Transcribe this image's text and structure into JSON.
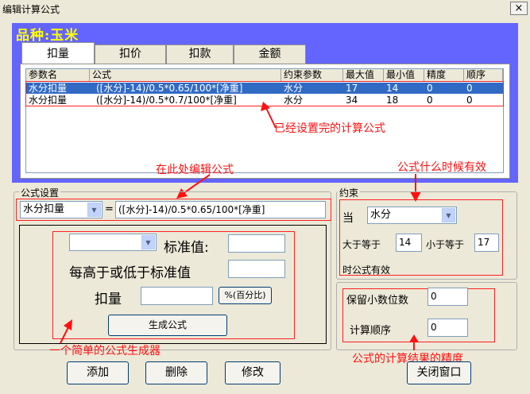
{
  "window": {
    "title": "编辑计算公式",
    "close_glyph": "×"
  },
  "variety": {
    "label": "品种:玉米"
  },
  "tabs": [
    {
      "label": "扣量"
    },
    {
      "label": "扣价"
    },
    {
      "label": "扣款"
    },
    {
      "label": "金额"
    }
  ],
  "table": {
    "columns": [
      "参数名",
      "公式",
      "约束参数",
      "最大值",
      "最小值",
      "精度",
      "顺序"
    ],
    "rows": [
      [
        "水分扣量",
        "([水分]-14)/0.5*0.65/100*[净重]",
        "水分",
        "17",
        "14",
        "0",
        "0"
      ],
      [
        "水分扣量",
        "([水分]-14)/0.5*0.7/100*[净重]",
        "水分",
        "34",
        "18",
        "0",
        "0"
      ]
    ]
  },
  "annotations": {
    "saved": "已经设置完的计算公式",
    "edit_here": "在此处编辑公式",
    "when_valid": "公式什么时候有效",
    "generator": "一个简单的公式生成器",
    "precision": "公式的计算结果的精度"
  },
  "formula": {
    "group_label": "公式设置",
    "param_select": "水分扣量",
    "equals": "=",
    "expression": "([水分]-14)/0.5*0.65/100*[净重]"
  },
  "generator": {
    "standard_label": "标准值:",
    "step_label": "每高于或低于标准值",
    "deduct_label": "扣量",
    "percent_button": "%(百分比)",
    "generate_button": "生成公式"
  },
  "constraint": {
    "group_label": "约束",
    "when_label": "当",
    "param": "水分",
    "gte_label": "大于等于",
    "gte_value": "14",
    "lte_label": "小于等于",
    "lte_value": "17",
    "valid_label": "时公式有效"
  },
  "precision": {
    "decimals_label": "保留小数位数",
    "decimals_value": "0",
    "order_label": "计算顺序",
    "order_value": "0"
  },
  "buttons": {
    "add": "添加",
    "delete": "删除",
    "modify": "修改",
    "close": "关闭窗口"
  },
  "colors": {
    "panel_blue": "#6464ff",
    "variety_text": "#ffff00",
    "annotation_red": "#ff1010",
    "selection": "#316ac5"
  }
}
